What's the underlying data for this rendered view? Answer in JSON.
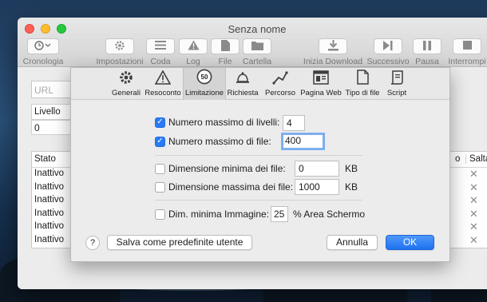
{
  "window": {
    "title": "Senza nome"
  },
  "toolbar": [
    {
      "label": "Cronologia",
      "icon": "clock-icon"
    },
    {
      "label": "Impostazioni",
      "icon": "gear-icon"
    },
    {
      "label": "Coda",
      "icon": "list-icon"
    },
    {
      "label": "Log",
      "icon": "warning-icon"
    },
    {
      "label": "File",
      "icon": "file-icon"
    },
    {
      "label": "Cartella",
      "icon": "folder-icon"
    },
    {
      "label": "Inizia Download",
      "icon": "download-icon"
    },
    {
      "label": "Successivo",
      "icon": "next-icon"
    },
    {
      "label": "Pausa",
      "icon": "pause-icon"
    },
    {
      "label": "Interrompi",
      "icon": "stop-icon"
    }
  ],
  "main": {
    "url_placeholder": "URL",
    "livello_header": "Livello",
    "livello_value": "0",
    "table": {
      "col_stato": "Stato",
      "col_o": "o",
      "col_salta": "Salta",
      "rows": [
        "Inattivo",
        "Inattivo",
        "Inattivo",
        "Inattivo",
        "Inattivo",
        "Inattivo"
      ]
    }
  },
  "sheet": {
    "tabs": [
      {
        "label": "Generali",
        "icon": "gear-icon"
      },
      {
        "label": "Resoconto",
        "icon": "warning-icon"
      },
      {
        "label": "Limitazione",
        "icon": "speed-limit-icon",
        "badge": "50",
        "selected": true
      },
      {
        "label": "Richiesta",
        "icon": "bell-icon"
      },
      {
        "label": "Percorso",
        "icon": "path-icon"
      },
      {
        "label": "Pagina Web",
        "icon": "webpage-icon"
      },
      {
        "label": "Tipo di file",
        "icon": "document-icon"
      },
      {
        "label": "Script",
        "icon": "script-icon"
      }
    ],
    "options": {
      "max_levels": {
        "label": "Numero massimo di livelli:",
        "checked": true,
        "value": "4"
      },
      "max_files": {
        "label": "Numero massimo di file:",
        "checked": true,
        "value": "400"
      },
      "min_file_size": {
        "label": "Dimensione minima dei file:",
        "checked": false,
        "value": "0",
        "unit": "KB"
      },
      "max_file_size": {
        "label": "Dimensione massima dei file:",
        "checked": false,
        "value": "1000",
        "unit": "KB"
      },
      "min_image": {
        "label": "Dim. minima Immagine:",
        "checked": false,
        "value": "25",
        "unit": "% Area Schermo"
      }
    },
    "help_label": "?",
    "save_default_label": "Salva come predefinite utente",
    "cancel_label": "Annulla",
    "ok_label": "OK"
  },
  "colors": {
    "accent": "#2a7bf6",
    "focus_ring": "#7eaef0"
  }
}
